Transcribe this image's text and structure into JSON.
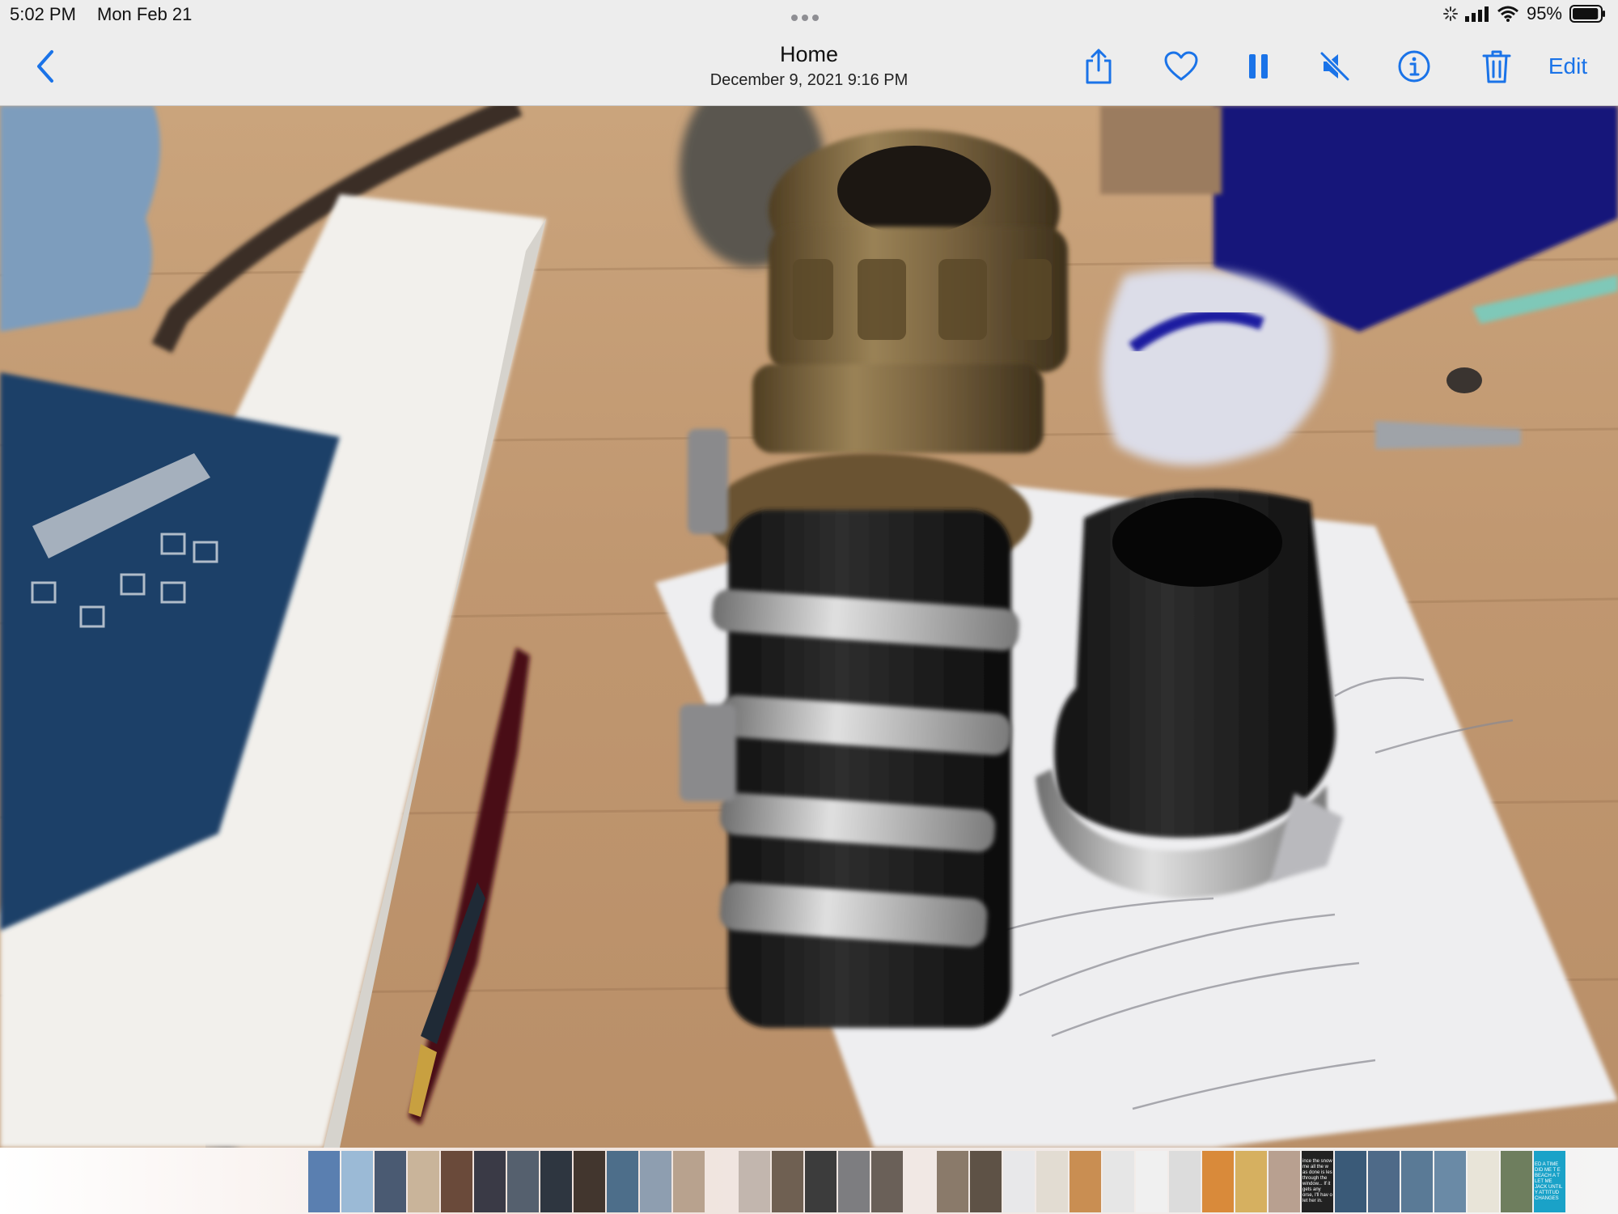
{
  "status_bar": {
    "time": "5:02 PM",
    "date": "Mon Feb 21",
    "battery_percent": "95%",
    "battery_level": 0.95
  },
  "nav": {
    "title": "Home",
    "subtitle": "December 9, 2021  9:16 PM",
    "edit_label": "Edit"
  },
  "colors": {
    "accent": "#1a73e8",
    "chrome_bg": "#ededed"
  },
  "icons": {
    "back": "chevron-left-icon",
    "share": "share-icon",
    "favorite": "heart-icon",
    "pause": "pause-icon",
    "mute": "speaker-muted-icon",
    "info": "info-icon",
    "delete": "trash-icon"
  },
  "filmstrip": {
    "thumbs": [
      {
        "color": "#5a7fb0",
        "text": ""
      },
      {
        "color": "#9bbad6",
        "text": ""
      },
      {
        "color": "#4a5a72",
        "text": ""
      },
      {
        "color": "#c9b49a",
        "text": ""
      },
      {
        "color": "#6a4a3a",
        "text": ""
      },
      {
        "color": "#3a3a46",
        "text": ""
      },
      {
        "color": "#55606e",
        "text": ""
      },
      {
        "color": "#2e3640",
        "text": ""
      },
      {
        "color": "#42362e",
        "text": ""
      },
      {
        "color": "#4d6e8a",
        "text": ""
      },
      {
        "color": "#8e9eb0",
        "text": ""
      },
      {
        "color": "#b8a28e",
        "text": ""
      },
      {
        "color": "#c2b6ae",
        "text": ""
      },
      {
        "color": "#6f6052",
        "text": ""
      },
      {
        "color": "#3c3c3c",
        "text": ""
      },
      {
        "color": "#7d7d80",
        "text": ""
      },
      {
        "color": "#6a6058",
        "text": ""
      },
      {
        "color": "#8a7a6a",
        "text": ""
      },
      {
        "color": "#5e5246",
        "text": ""
      },
      {
        "color": "#e8e8ea",
        "text": ""
      },
      {
        "color": "#e2dcd2",
        "text": ""
      },
      {
        "color": "#c98e52",
        "text": ""
      },
      {
        "color": "#e6e6e6",
        "text": ""
      },
      {
        "color": "#f0f0f0",
        "text": ""
      },
      {
        "color": "#dcdcdc",
        "text": ""
      },
      {
        "color": "#d98a3a",
        "text": ""
      },
      {
        "color": "#d6b060",
        "text": ""
      },
      {
        "color": "#b8a090",
        "text": ""
      },
      {
        "color": "#222222",
        "text": "ince the snow me all the w as done is les through the window... If it gets any orse, I'll hav o let her in."
      },
      {
        "color": "#3a5a78",
        "text": ""
      },
      {
        "color": "#4e6a88",
        "text": ""
      },
      {
        "color": "#5a7a96",
        "text": ""
      },
      {
        "color": "#6a8aa6",
        "text": ""
      },
      {
        "color": "#e8e4d8",
        "text": ""
      },
      {
        "color": "#6e7e5e",
        "text": ""
      },
      {
        "color": "#1aa2c8",
        "text": "ED A TIME DID ME T E BEACH A T LET ME JACK UNTIL Y ATTITUD CHANGES"
      }
    ]
  }
}
